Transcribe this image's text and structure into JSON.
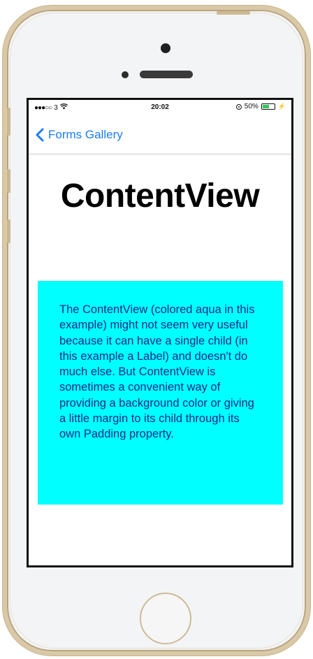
{
  "status_bar": {
    "carrier": "3",
    "time": "20:02",
    "battery_percent": "50%",
    "battery_level": 0.5,
    "battery_color": "#34c759",
    "icons": [
      "signal-dots-icon",
      "wifi-icon",
      "rotation-lock-icon",
      "battery-icon",
      "charging-icon"
    ]
  },
  "nav": {
    "back_label": "Forms Gallery",
    "accent_color": "#1a7cf5"
  },
  "page": {
    "title": "ContentView"
  },
  "content_view": {
    "background_color": "#00ffff",
    "text_color": "#0a2a8a",
    "label": "The ContentView (colored aqua in this example) might not seem very useful because it can have a single child (in this example a Label) and doesn't do much else. But ContentView is sometimes a convenient way of providing a background color or giving a little margin to its child through its own Padding property."
  }
}
